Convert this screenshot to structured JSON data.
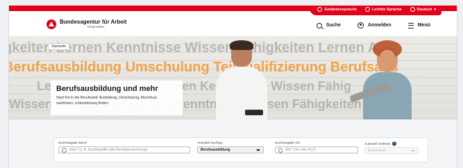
{
  "utility": {
    "links": [
      {
        "label": "Gebärdensprache",
        "icon": "sign-language-icon"
      },
      {
        "label": "Leichte Sprache",
        "icon": "easy-language-icon"
      },
      {
        "label": "Deutsch",
        "icon": "globe-icon"
      }
    ]
  },
  "header": {
    "logo_title": "Bundesagentur für Arbeit",
    "logo_tagline": "bringt weiter.",
    "nav": [
      {
        "label": "Suche",
        "icon": "search-icon"
      },
      {
        "label": "Anmelden",
        "icon": "user-icon"
      },
      {
        "label": "Menü",
        "icon": "menu-icon"
      }
    ]
  },
  "hero": {
    "breadcrumb": "Startseite",
    "background_words": {
      "row1": "gkeiten  Lernen  Kenntnisse  Wissen  Fähigkeiten  Lernen  A",
      "row2": "Berufsausbildung  Umschulung  Teilqualifizierung  Berufsabs",
      "row3": "Lernen  Fähigkeiten  Lernen  Kenntnisse  Wissen  Fähig",
      "row4": "Wissen  Fähigkeiten  Lernen  Kenntnisse  Wissen  Fähigkeiten  Lerne"
    },
    "title": "Berufsausbildung und mehr",
    "text": "Start frei in die Berufswelt: Ausbildung, Umschulung, Abschluss nachholen, Unterstützung finden."
  },
  "search": {
    "beruf": {
      "label": "Sucheingabe Beruf",
      "placeholder": "Was? (z. B. Suchbegriffe oder Berufsbezeichnung)"
    },
    "suchtyp": {
      "label": "Auswahl Suchtyp",
      "value": "Berufsausbildung"
    },
    "ort": {
      "label": "Sucheingabe Ort",
      "placeholder": "Wo? (Ort oder PLZ)"
    },
    "umkreis": {
      "label": "Auswahl Umkreis",
      "value": "Bundesweit",
      "info": "i"
    }
  },
  "colors": {
    "brand_red": "#e2001a",
    "accent_orange": "#f2a24a"
  }
}
